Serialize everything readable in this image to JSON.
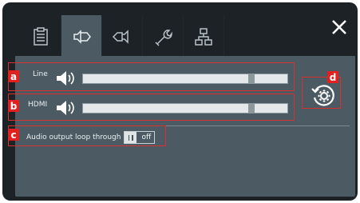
{
  "tabs": [
    {
      "icon": "clipboard-icon"
    },
    {
      "icon": "audio-output-icon",
      "active": true
    },
    {
      "icon": "audio-input-icon"
    },
    {
      "icon": "wrench-icon"
    },
    {
      "icon": "network-icon"
    }
  ],
  "close_icon": "close-icon",
  "audio": {
    "line": {
      "label": "Line",
      "level": 0.81
    },
    "hdmi": {
      "label": "HDMI",
      "level": 0.81
    },
    "loop_through": {
      "label": "Audio output loop through",
      "toggle_text": "off"
    }
  },
  "reset_icon": "reset-settings-icon",
  "callouts": {
    "a": "a",
    "b": "b",
    "c": "c",
    "d": "d"
  },
  "colors": {
    "accent": "#e1211f",
    "panel": "#1c2226",
    "content": "#4c5b63"
  }
}
